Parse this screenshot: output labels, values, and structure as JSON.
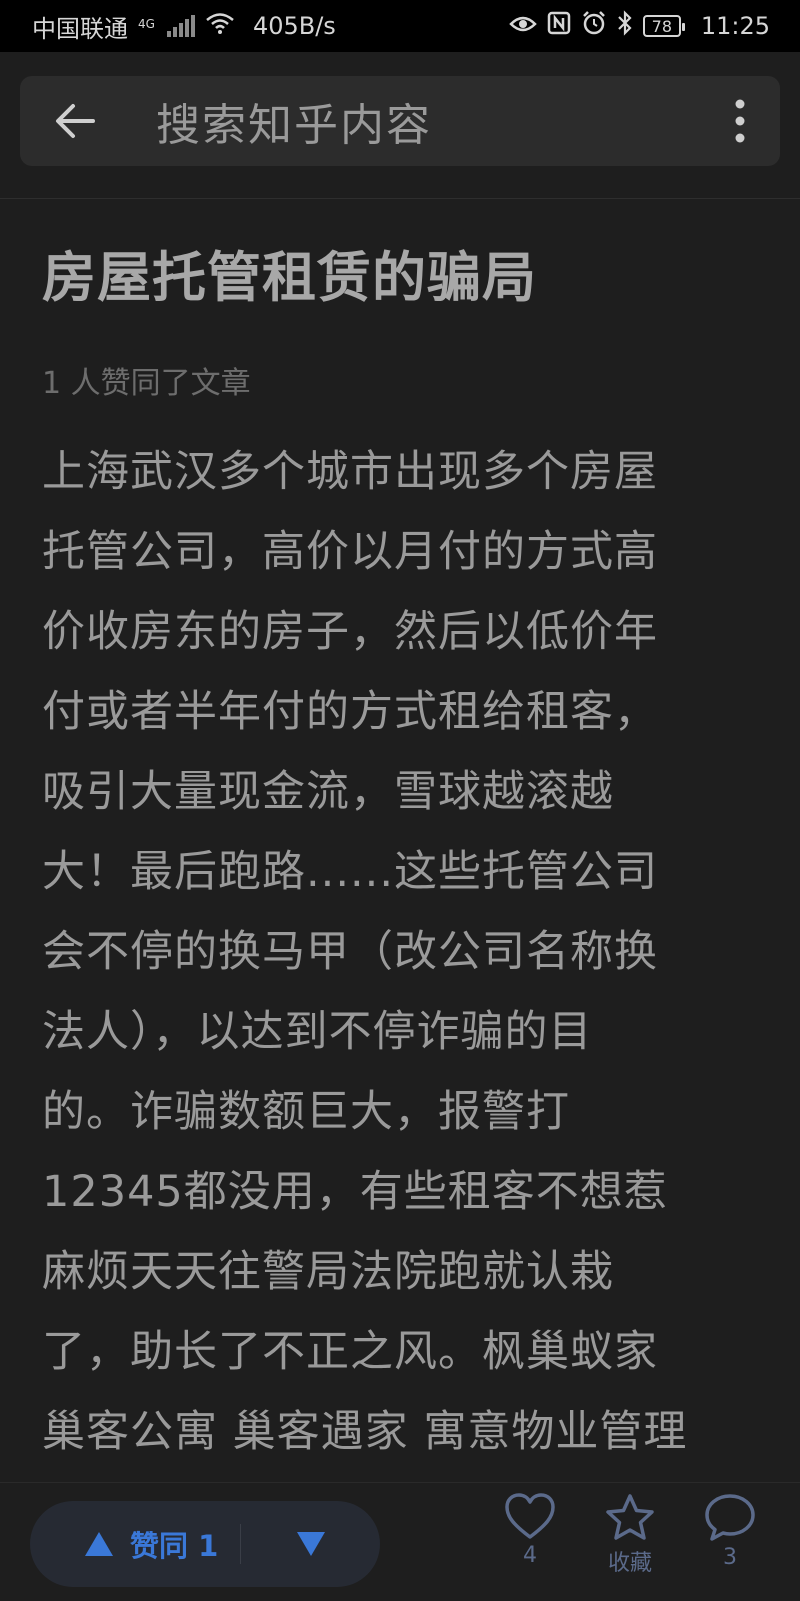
{
  "status_bar": {
    "carrier": "中国联通",
    "network": "4G",
    "speed": "405B/s",
    "battery": "78",
    "time": "11:25"
  },
  "search": {
    "placeholder": "搜索知乎内容"
  },
  "article": {
    "title": "房屋托管租赁的骗局",
    "meta": "1 人赞同了文章",
    "lines": [
      "上海武汉多个城市出现多个房屋",
      "托管公司，高价以月付的方式高",
      "价收房东的房子，然后以低价年",
      "付或者半年付的方式租给租客，",
      "吸引大量现金流，雪球越滚越",
      "大！最后跑路......这些托管公司",
      "会不停的换马甲（改公司名称换",
      "法人），以达到不停诈骗的目",
      "的。诈骗数额巨大，报警打",
      "12345都没用，有些租客不想惹",
      "麻烦天天往警局法院跑就认栽",
      "了，助长了不正之风。枫巢蚁家",
      "巢客公寓 巢客遇家 寓意物业管理"
    ]
  },
  "bottom_bar": {
    "upvote_label": "赞同 1",
    "like_count": "4",
    "collect_label": "收藏",
    "comment_count": "3"
  },
  "colors": {
    "accent": "#3a78d8",
    "background": "#1e1e1e",
    "action_icon": "#5b6a8a"
  }
}
